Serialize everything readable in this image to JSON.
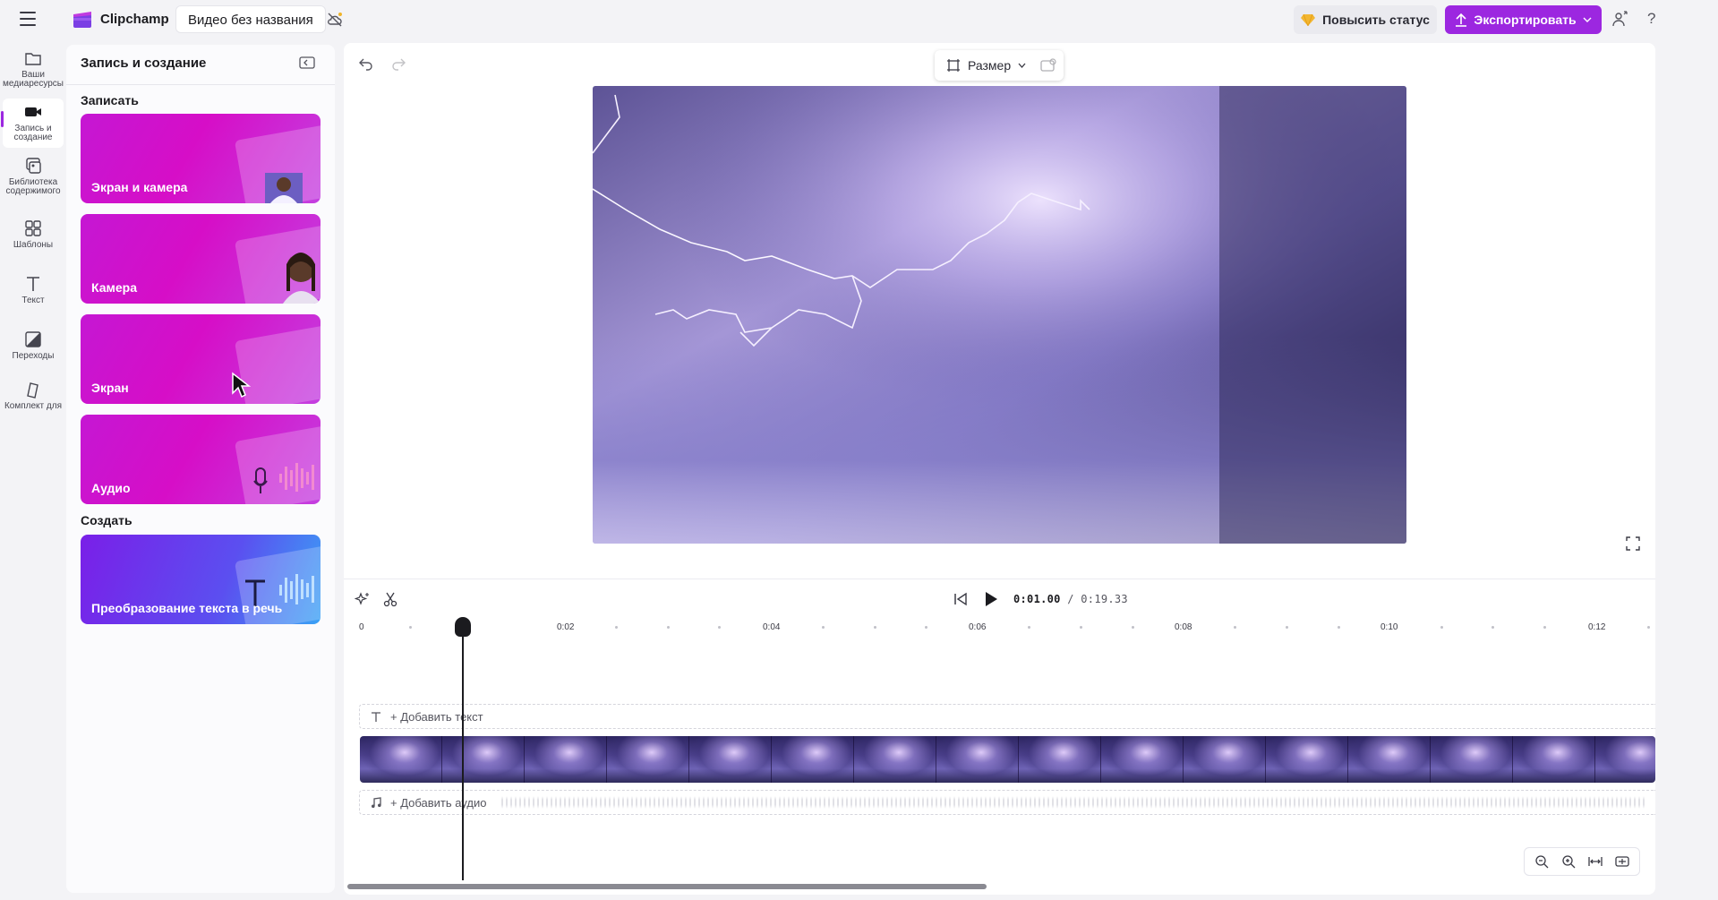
{
  "header": {
    "app_name": "Clipchamp",
    "project_title": "Видео без названия",
    "upgrade_label": "Повысить статус",
    "export_label": "Экспортировать",
    "help_label": "?"
  },
  "rail": {
    "items": [
      {
        "label": "Ваши медиаресурсы",
        "icon": "folder-icon"
      },
      {
        "label": "Запись и создание",
        "icon": "video-camera-icon"
      },
      {
        "label": "Библиотека содержимого",
        "icon": "library-icon"
      },
      {
        "label": "Шаблоны",
        "icon": "templates-icon"
      },
      {
        "label": "Текст",
        "icon": "text-icon"
      },
      {
        "label": "Переходы",
        "icon": "transitions-icon"
      },
      {
        "label": "Комплект для",
        "icon": "brand-kit-icon"
      }
    ]
  },
  "panel": {
    "title": "Запись и создание",
    "record_section": "Записать",
    "create_section": "Создать",
    "cards": [
      {
        "label": "Экран и камера"
      },
      {
        "label": "Камера"
      },
      {
        "label": "Экран"
      },
      {
        "label": "Аудио"
      },
      {
        "label": "Преобразование текста в речь"
      }
    ]
  },
  "editor": {
    "size_label": "Размер"
  },
  "playback": {
    "current_time": "0:01.00",
    "total_time": "/ 0:19.33"
  },
  "timeline": {
    "ruler": [
      "0",
      "0:02",
      "0:04",
      "0:06",
      "0:08",
      "0:10",
      "0:12"
    ],
    "add_text": "+ Добавить текст",
    "add_audio": "+ Добавить аудио"
  },
  "colors": {
    "accent": "#9c27e0",
    "upgrade_bg": "#eaeaef",
    "card_gradient_start": "#c517d3",
    "tts_gradient_end": "#3aa2f5"
  }
}
